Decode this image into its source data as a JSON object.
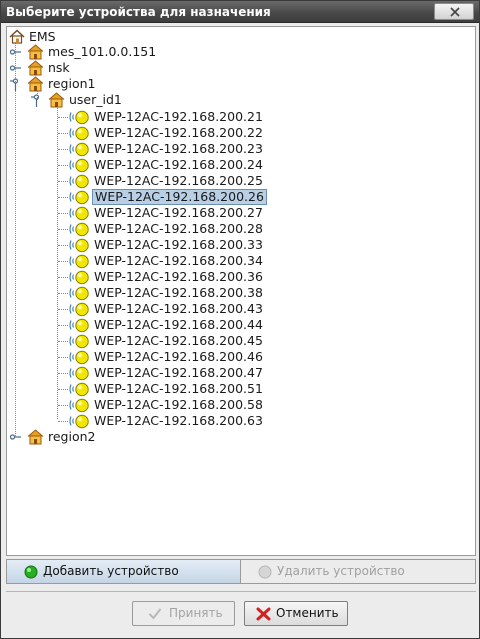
{
  "window": {
    "title": "Выберите устройства для назначения"
  },
  "tree": {
    "root": {
      "label": "EMS",
      "icon": "home-icon"
    },
    "nodes": [
      {
        "label": "mes_101.0.0.151",
        "icon": "house-folder-icon",
        "expanded": false
      },
      {
        "label": "nsk",
        "icon": "house-folder-icon",
        "expanded": false
      },
      {
        "label": "region1",
        "icon": "house-folder-icon",
        "expanded": true
      },
      {
        "label": "region2",
        "icon": "house-folder-icon",
        "expanded": false
      }
    ],
    "user": {
      "label": "user_id1",
      "icon": "house-folder-icon",
      "expanded": true
    },
    "devices": [
      "WEP-12AC-192.168.200.21",
      "WEP-12AC-192.168.200.22",
      "WEP-12AC-192.168.200.23",
      "WEP-12AC-192.168.200.24",
      "WEP-12AC-192.168.200.25",
      "WEP-12AC-192.168.200.26",
      "WEP-12AC-192.168.200.27",
      "WEP-12AC-192.168.200.28",
      "WEP-12AC-192.168.200.33",
      "WEP-12AC-192.168.200.34",
      "WEP-12AC-192.168.200.36",
      "WEP-12AC-192.168.200.38",
      "WEP-12AC-192.168.200.43",
      "WEP-12AC-192.168.200.44",
      "WEP-12AC-192.168.200.45",
      "WEP-12AC-192.168.200.46",
      "WEP-12AC-192.168.200.47",
      "WEP-12AC-192.168.200.51",
      "WEP-12AC-192.168.200.58",
      "WEP-12AC-192.168.200.63"
    ],
    "selected_device": "WEP-12AC-192.168.200.26",
    "device_icon": "wireless-access-point-icon"
  },
  "actions": {
    "add_label": "Добавить устройство",
    "remove_label": "Удалить устройство",
    "add_icon": "green-dot-icon",
    "remove_icon": "gray-dot-icon"
  },
  "dialog": {
    "accept_label": "Принять",
    "cancel_label": "Отменить",
    "accept_icon": "check-icon",
    "cancel_icon": "red-x-icon"
  },
  "colors": {
    "selection": "#b8cfe5",
    "device_dot": "#f2e600",
    "cancel_x": "#d42020",
    "add_dot": "#26b020"
  }
}
